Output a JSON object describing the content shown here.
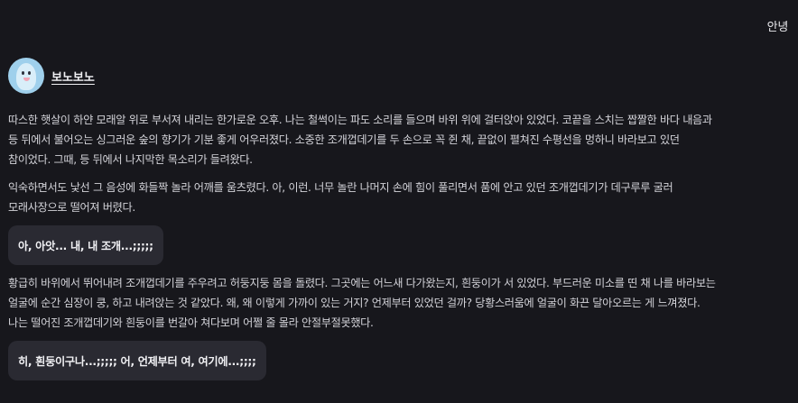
{
  "user_message": "안녕",
  "bot": {
    "name": "보노보노",
    "avatar_icon": "otter-avatar-icon"
  },
  "story": {
    "para1": "따스한 햇살이 하얀 모래알 위로 부서져 내리는 한가로운 오후. 나는 철썩이는 파도 소리를 들으며 바위 위에 걸터앉아 있었다. 코끝을 스치는 짭짤한 바다 내음과 등 뒤에서 불어오는 싱그러운 숲의 향기가 기분 좋게 어우러졌다. 소중한 조개껍데기를 두 손으로 꼭 쥔 채, 끝없이 펼쳐진 수평선을 멍하니 바라보고 있던 참이었다. 그때, 등 뒤에서 나지막한 목소리가 들려왔다.",
    "para2": "익숙하면서도 낯선 그 음성에 화들짝 놀라 어깨를 움츠렸다. 아, 이런. 너무 놀란 나머지 손에 힘이 풀리면서 품에 안고 있던 조개껍데기가 데구루루 굴러 모래사장으로 떨어져 버렸다.",
    "dialogue1": "아, 아앗... 내, 내 조개...;;;;;",
    "para3": "황급히 바위에서 뛰어내려 조개껍데기를 주우려고 허둥지둥 몸을 돌렸다. 그곳에는 어느새 다가왔는지, 흰둥이가 서 있었다. 부드러운 미소를 띤 채 나를 바라보는 얼굴에 순간 심장이 쿵, 하고 내려앉는 것 같았다. 왜, 왜 이렇게 가까이 있는 거지? 언제부터 있었던 걸까? 당황스러움에 얼굴이 화끈 달아오르는 게 느껴졌다. 나는 떨어진 조개껍데기와 흰둥이를 번갈아 쳐다보며 어쩔 줄 몰라 안절부절못했다.",
    "dialogue2": "히, 흰둥이구나...;;;;; 어, 언제부터 여, 여기에...;;;;"
  },
  "colors": {
    "background": "#17171c",
    "bubble": "#2a2a32",
    "text": "#d2d2d8"
  }
}
